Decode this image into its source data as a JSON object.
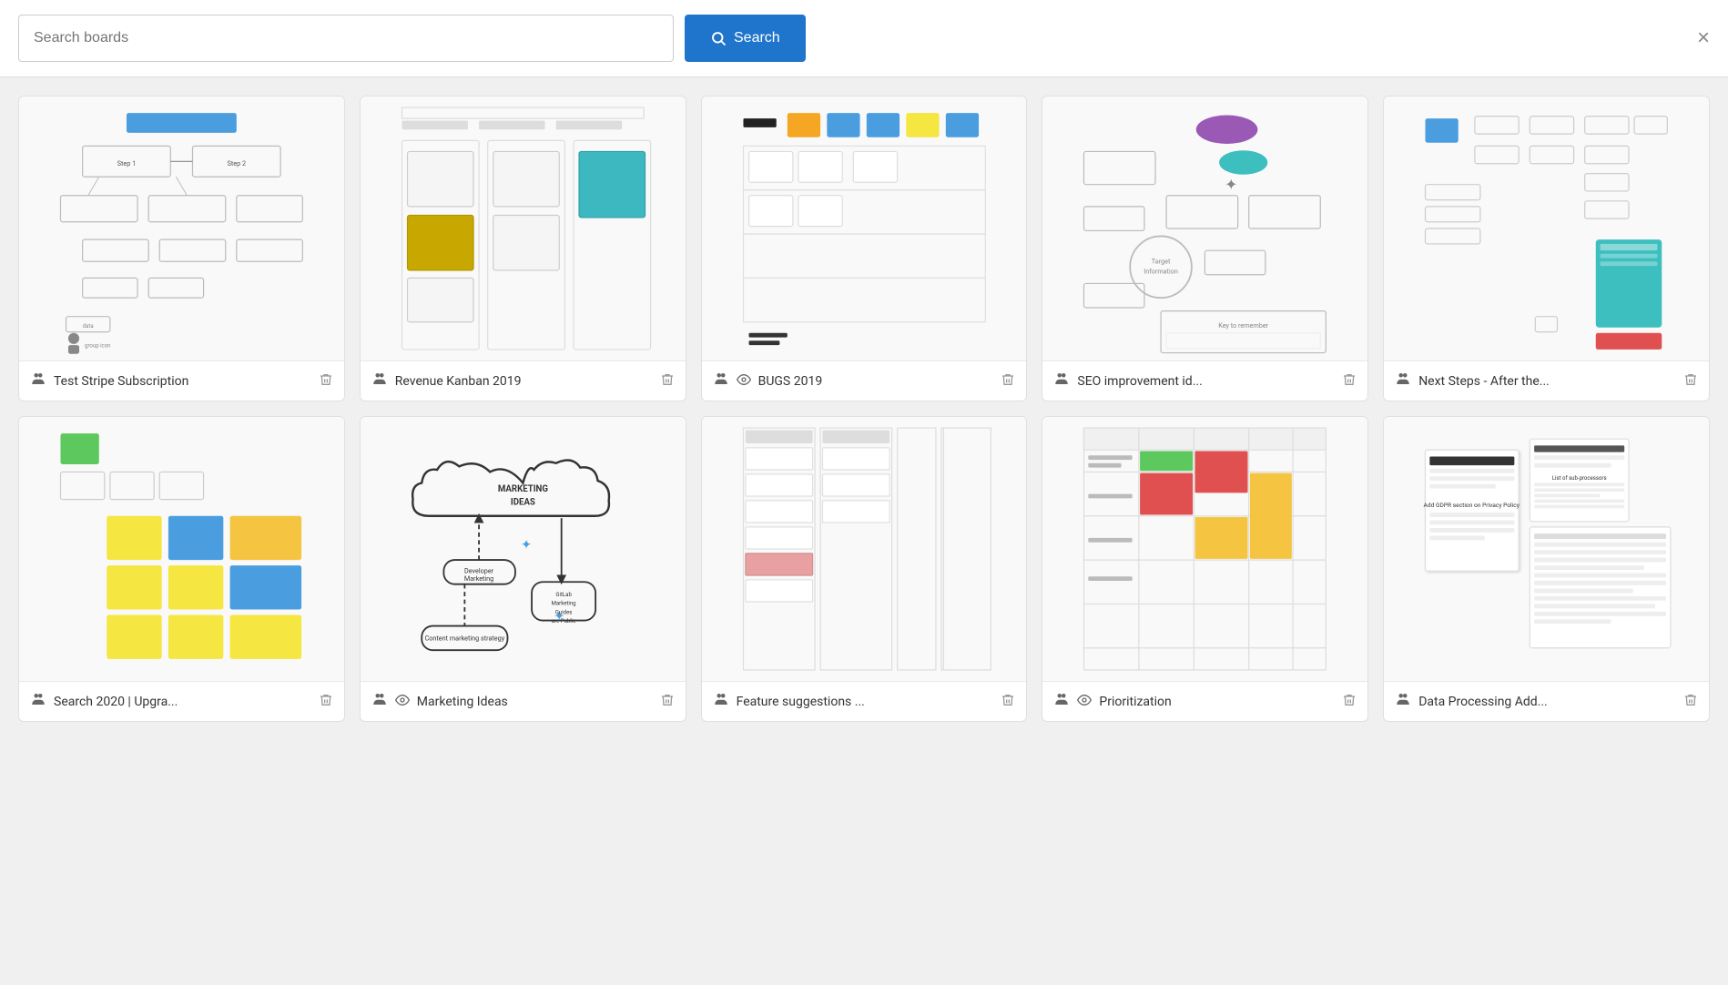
{
  "header": {
    "search_placeholder": "Search boards",
    "search_button_label": "Search",
    "close_label": "×"
  },
  "boards": [
    {
      "id": 1,
      "name": "Test Stripe Subscription",
      "has_group": true,
      "has_eye": false,
      "preview_type": "flowchart_blue",
      "row": 1
    },
    {
      "id": 2,
      "name": "Revenue Kanban 2019",
      "has_group": true,
      "has_eye": false,
      "preview_type": "kanban_yellow",
      "row": 1
    },
    {
      "id": 3,
      "name": "BUGS 2019",
      "has_group": true,
      "has_eye": true,
      "preview_type": "bugs_board",
      "row": 1
    },
    {
      "id": 4,
      "name": "SEO improvement id...",
      "has_group": true,
      "has_eye": false,
      "preview_type": "seo_mindmap",
      "row": 1
    },
    {
      "id": 5,
      "name": "Next Steps - After the...",
      "has_group": true,
      "has_eye": false,
      "preview_type": "next_steps",
      "row": 1
    },
    {
      "id": 6,
      "name": "Search 2020 | Upgra...",
      "has_group": true,
      "has_eye": false,
      "preview_type": "search_2020",
      "row": 2
    },
    {
      "id": 7,
      "name": "Marketing Ideas",
      "has_group": true,
      "has_eye": true,
      "preview_type": "marketing_ideas",
      "row": 2
    },
    {
      "id": 8,
      "name": "Feature suggestions ...",
      "has_group": true,
      "has_eye": false,
      "preview_type": "feature_suggestions",
      "row": 2
    },
    {
      "id": 9,
      "name": "Prioritization",
      "has_group": true,
      "has_eye": true,
      "preview_type": "prioritization",
      "row": 2
    },
    {
      "id": 10,
      "name": "Data Processing Add...",
      "has_group": true,
      "has_eye": false,
      "preview_type": "data_processing",
      "row": 2
    }
  ]
}
